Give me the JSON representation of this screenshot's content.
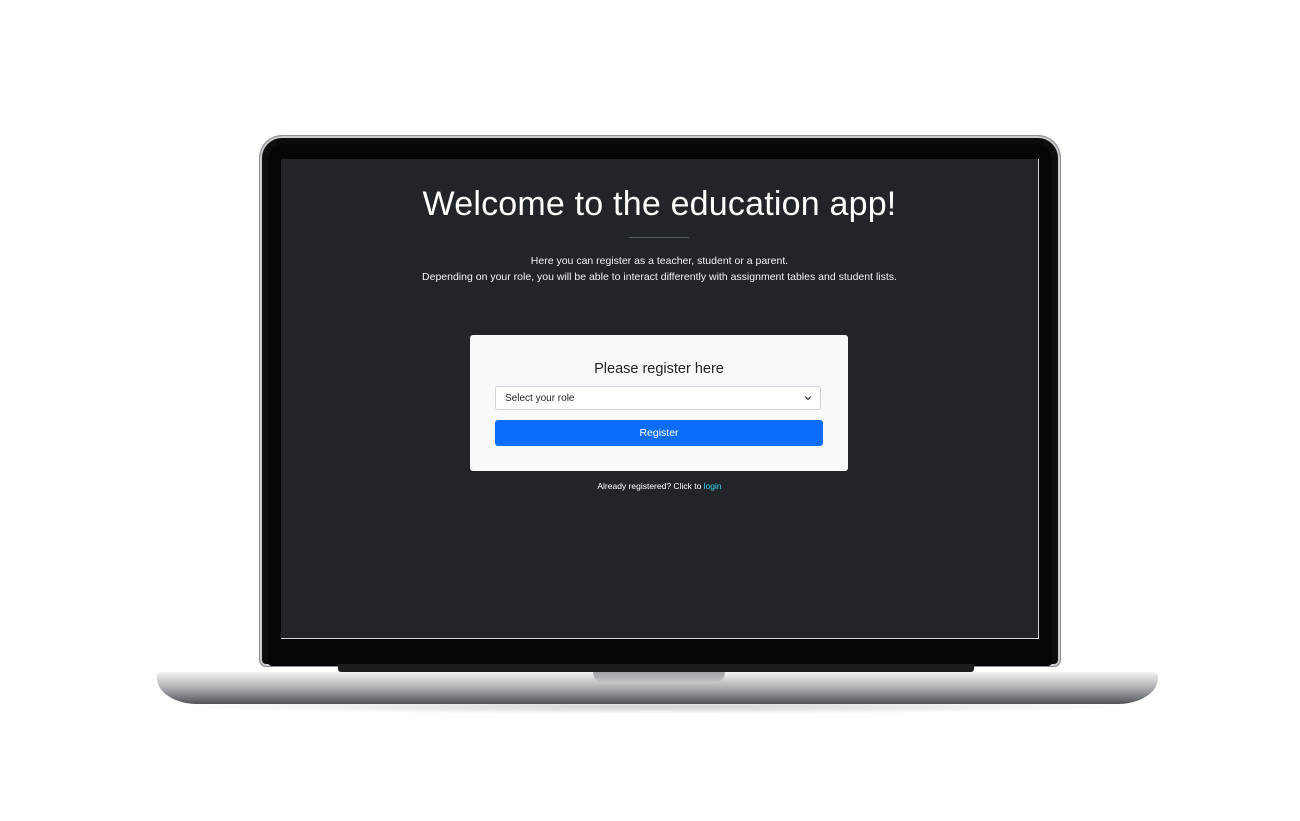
{
  "hero": {
    "title": "Welcome to the education app!",
    "line1": "Here you can register as a teacher, student or a parent.",
    "line2": "Depending on your role, you will be able to interact differently with assignment tables and student lists."
  },
  "register_card": {
    "title": "Please register here",
    "select_value": "Select your role",
    "button_label": "Register"
  },
  "login_prompt": {
    "text": "Already registered? Click to ",
    "link_label": "login"
  },
  "colors": {
    "screen_background": "#212529",
    "card_background": "#f8f9fa",
    "primary_button": "#0d6efd",
    "link": "#3dd5f3"
  },
  "icons": {
    "select_caret": "chevron-down-icon"
  }
}
